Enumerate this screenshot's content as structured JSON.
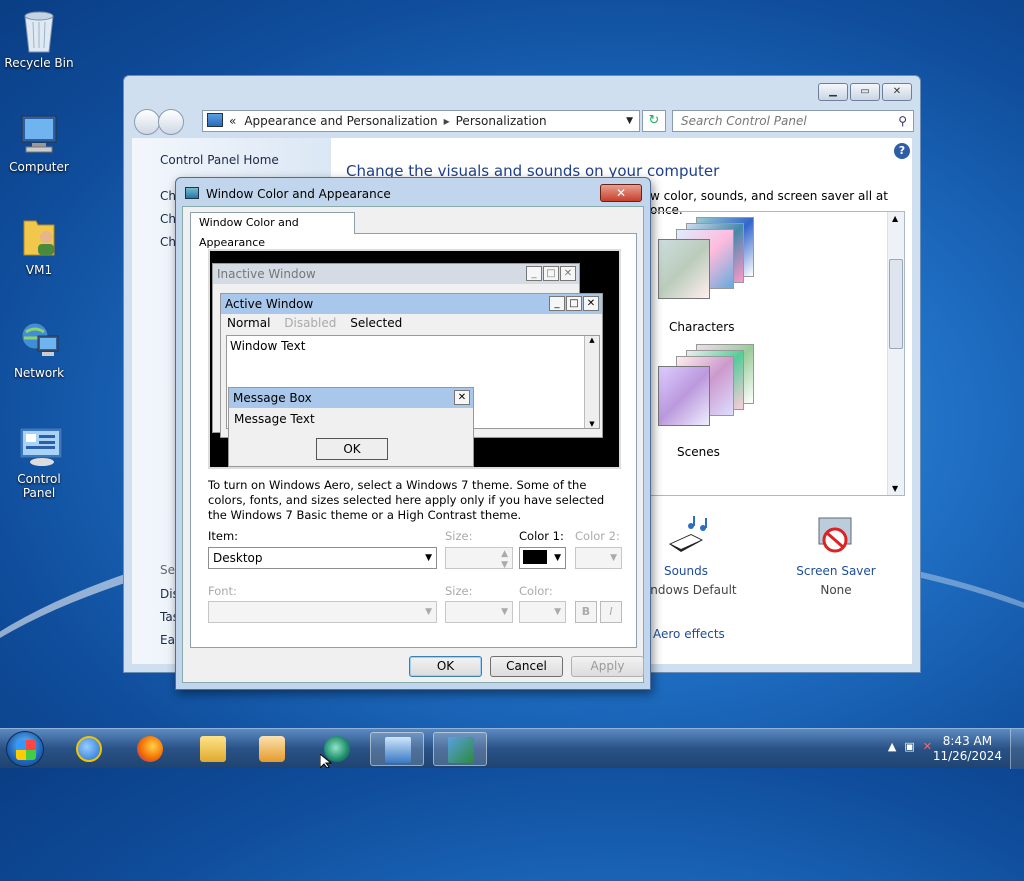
{
  "desktop": {
    "icons": [
      {
        "label": "Recycle Bin"
      },
      {
        "label": "Computer"
      },
      {
        "label": "VM1"
      },
      {
        "label": "Network"
      },
      {
        "label": "Control Panel"
      }
    ]
  },
  "control_panel": {
    "address": {
      "overflow": "«",
      "part1": "Appearance and Personalization",
      "part2": "Personalization"
    },
    "search_placeholder": "Search Control Panel",
    "left": {
      "home": "Control Panel Home",
      "links_truncated": [
        "Ch",
        "Ch",
        "Ch"
      ],
      "see_also_truncated": [
        "See",
        "Dis",
        "Tas",
        "Eas"
      ]
    },
    "main": {
      "title": "Change the visuals and sounds on your computer",
      "subtitle_visible": "w color, sounds, and screen saver all at once.",
      "themes": [
        {
          "name": "Characters"
        },
        {
          "name": "Scenes"
        }
      ],
      "sounds": {
        "label": "Sounds",
        "value": "Windows Default"
      },
      "screen_saver": {
        "label": "Screen Saver",
        "value": "None"
      },
      "aero_link": "Aero effects"
    }
  },
  "dialog": {
    "title": "Window Color and Appearance",
    "tab": "Window Color and Appearance",
    "preview": {
      "inactive": "Inactive Window",
      "active": "Active Window",
      "menu": [
        "Normal",
        "Disabled",
        "Selected"
      ],
      "window_text": "Window Text",
      "message_box": "Message Box",
      "message_text": "Message Text",
      "ok": "OK"
    },
    "description": "To turn on Windows Aero, select a Windows 7 theme.  Some of the colors, fonts, and sizes selected here apply only if you have selected the Windows 7 Basic theme or a High Contrast theme.",
    "item_label": "Item:",
    "item_value": "Desktop",
    "size_label": "Size:",
    "color1_label": "Color 1:",
    "color1_value": "#000000",
    "color2_label": "Color 2:",
    "font_label": "Font:",
    "font_size_label": "Size:",
    "font_color_label": "Color:",
    "bold": "B",
    "italic": "I",
    "buttons": {
      "ok": "OK",
      "cancel": "Cancel",
      "apply": "Apply"
    }
  },
  "taskbar": {
    "time": "8:43 AM",
    "date": "11/26/2024"
  },
  "colors": {
    "accent": "#1e4d9a",
    "title_blue": "#1e3f8a"
  }
}
